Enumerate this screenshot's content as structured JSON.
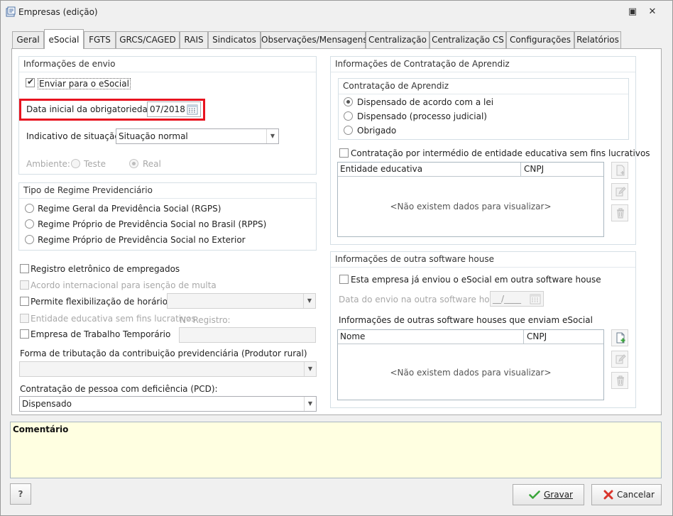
{
  "window": {
    "title": "Empresas (edição)",
    "controls": {
      "restore_glyph": "▣",
      "close_glyph": "✕"
    }
  },
  "tabs": [
    {
      "label": "Geral"
    },
    {
      "label": "eSocial",
      "active": true
    },
    {
      "label": "FGTS"
    },
    {
      "label": "GRCS/CAGED"
    },
    {
      "label": "RAIS"
    },
    {
      "label": "Sindicatos"
    },
    {
      "label": "Observações/Mensagens"
    },
    {
      "label": "Centralização"
    },
    {
      "label": "Centralização CS"
    },
    {
      "label": "Configurações"
    },
    {
      "label": "Relatórios"
    }
  ],
  "envio": {
    "title": "Informações de envio",
    "enviar_label": "Enviar para o eSocial",
    "enviar_checked": true,
    "data_label": "Data inicial da obrigatoriedade:",
    "data_value": "07/2018",
    "situacao_label": "Indicativo de situação:",
    "situacao_value": "Situação normal",
    "ambiente_label": "Ambiente:",
    "ambiente_teste": "Teste",
    "ambiente_real": "Real"
  },
  "regime": {
    "title": "Tipo de Regime Previdenciário",
    "options": [
      "Regime Geral da Previdência Social (RGPS)",
      "Regime Próprio de Previdência Social no Brasil (RPPS)",
      "Regime Próprio de Previdência Social no Exterior"
    ]
  },
  "flags": {
    "registro_eletronico": "Registro eletrônico de empregados",
    "acordo_internacional": "Acordo internacional para isenção de multa",
    "flexibilizacao": "Permite flexibilização de horários",
    "entidade_educativa": "Entidade educativa sem fins lucrativos",
    "registro_label": "Nº Registro:",
    "trabalho_temporario": "Empresa de Trabalho Temporário"
  },
  "tributacao": {
    "label": "Forma de tributação da contribuição previdenciária (Produtor rural)",
    "value": ""
  },
  "pcd": {
    "label": "Contratação de pessoa com deficiência (PCD):",
    "value": "Dispensado"
  },
  "aprendiz": {
    "title": "Informações de Contratação de Aprendiz",
    "sub_title": "Contratação de Aprendiz",
    "options": [
      "Dispensado de acordo com a lei",
      "Dispensado (processo judicial)",
      "Obrigado"
    ],
    "selected_index": 0,
    "intermedio_label": "Contratação por intermédio de entidade educativa sem fins lucrativos",
    "grid_columns": [
      "Entidade educativa",
      "CNPJ"
    ],
    "grid_empty": "<Não existem dados para visualizar>"
  },
  "software_house": {
    "title": "Informações de outra software house",
    "enviou_label": "Esta empresa já enviou o eSocial em outra software house",
    "data_label": "Data do envio na outra software house:",
    "data_value": "__/____",
    "outras_label": "Informações de outras software houses que enviam eSocial",
    "grid_columns": [
      "Nome",
      "CNPJ"
    ],
    "grid_empty": "<Não existem dados para visualizar>"
  },
  "comment": {
    "label": "Comentário"
  },
  "footer": {
    "help_label": "?",
    "save_label": "Gravar",
    "cancel_label": "Cancelar"
  },
  "colors": {
    "highlight": "#e8131f",
    "comment_bg": "#ffffe1",
    "save_icon": "#3aa53a",
    "cancel_icon": "#d9342b"
  }
}
